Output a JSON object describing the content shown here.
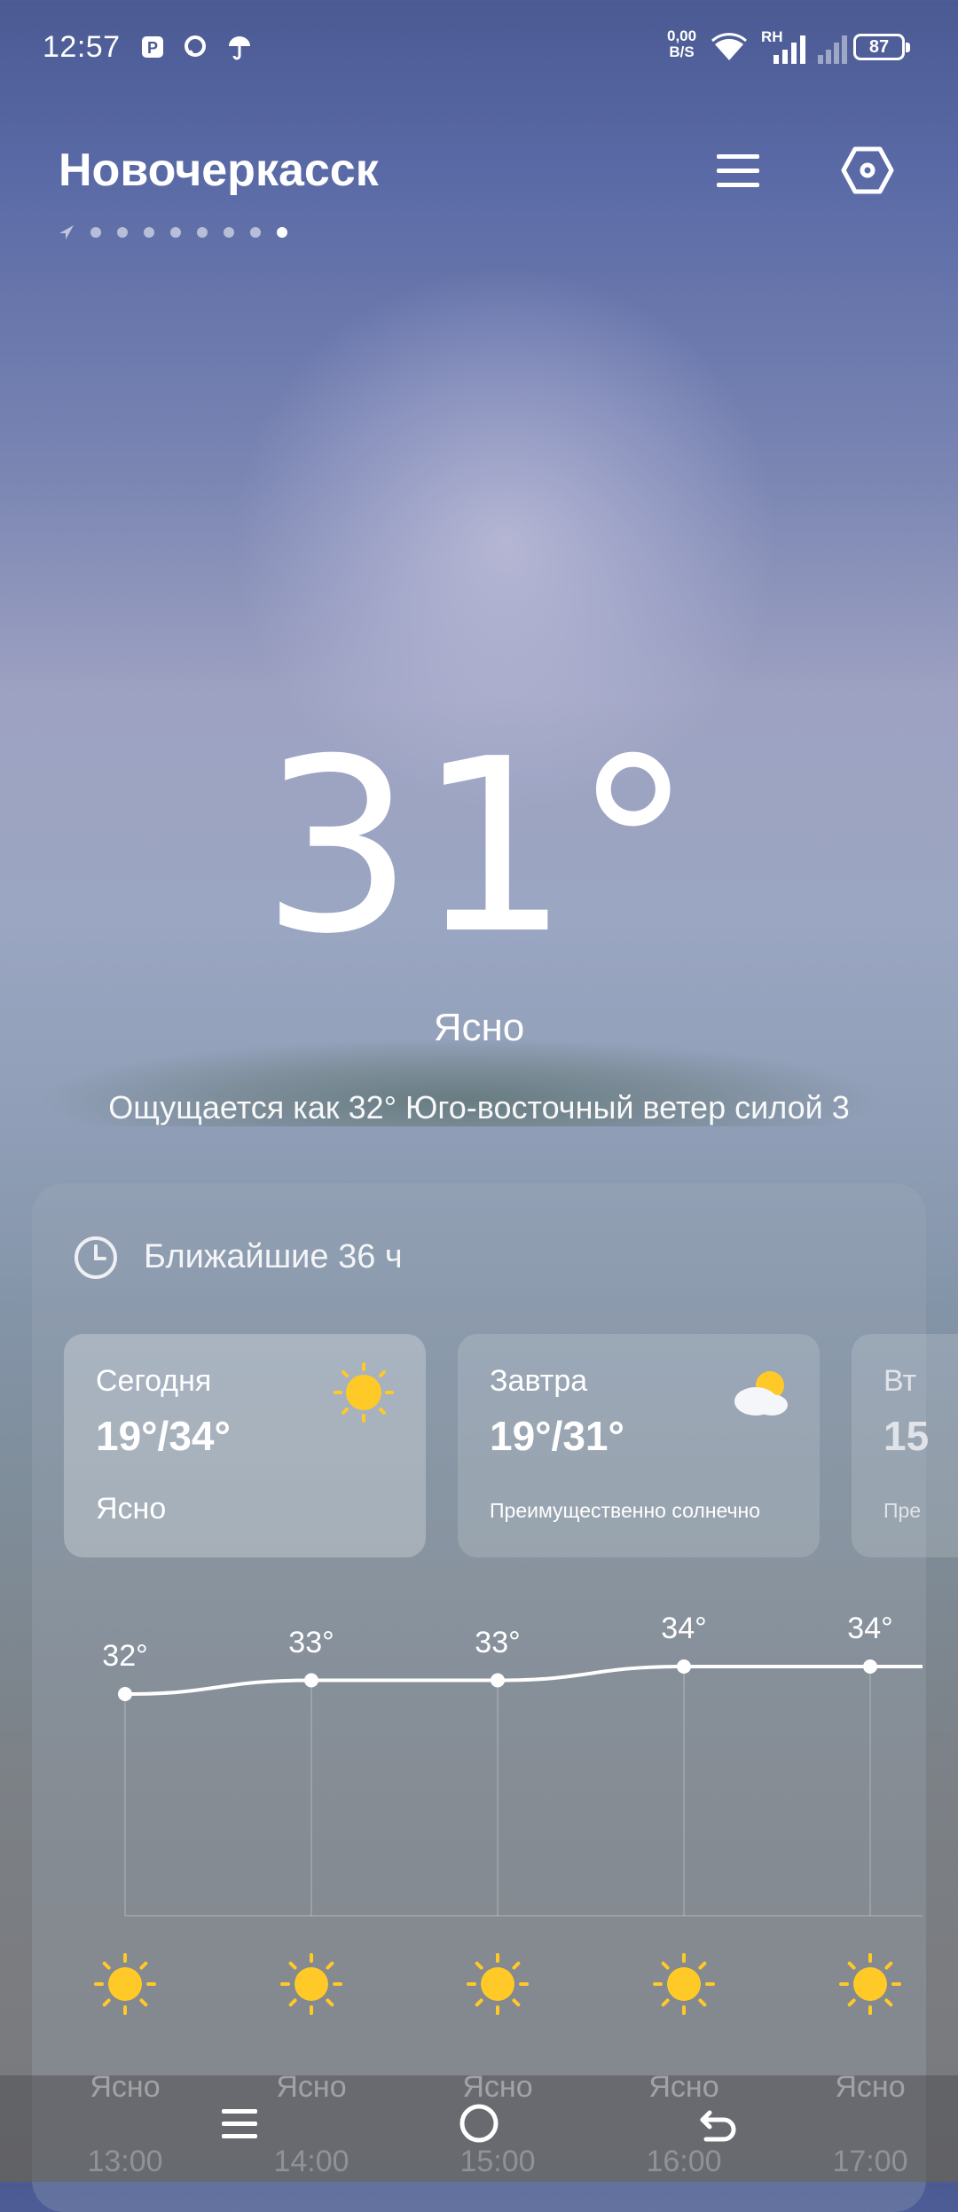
{
  "status_bar": {
    "time": "12:57",
    "net_speed_value": "0,00",
    "net_speed_unit": "B/S",
    "carrier": "RH",
    "battery": "87"
  },
  "header": {
    "city": "Новочеркасск",
    "menu_icon": "menu-icon",
    "settings_icon": "settings-hexagon-icon",
    "page_dots": 8,
    "active_page": 8
  },
  "current": {
    "temperature": "31°",
    "condition": "Ясно",
    "feels_like": "Ощущается как 32°  Юго-восточный ветер силой 3"
  },
  "forecast_card": {
    "title": "Ближайшие 36 ч",
    "days": [
      {
        "name": "Сегодня",
        "temps": "19°/34°",
        "desc": "Ясно",
        "icon": "sun-icon"
      },
      {
        "name": "Завтра",
        "temps": "19°/31°",
        "desc": "Преимущественно солнечно",
        "icon": "partly-cloudy-icon"
      },
      {
        "name": "Вт",
        "temps": "15",
        "desc": "Пре",
        "icon": ""
      }
    ],
    "hourly": [
      {
        "time": "13:00",
        "temp": "32°",
        "temp_value": 32,
        "cond": "Ясно",
        "icon": "sun-icon"
      },
      {
        "time": "14:00",
        "temp": "33°",
        "temp_value": 33,
        "cond": "Ясно",
        "icon": "sun-icon"
      },
      {
        "time": "15:00",
        "temp": "33°",
        "temp_value": 33,
        "cond": "Ясно",
        "icon": "sun-icon"
      },
      {
        "time": "16:00",
        "temp": "34°",
        "temp_value": 34,
        "cond": "Ясно",
        "icon": "sun-icon"
      },
      {
        "time": "17:00",
        "temp": "34°",
        "temp_value": 34,
        "cond": "Ясно",
        "icon": "sun-icon"
      }
    ]
  },
  "colors": {
    "sun": "#ffc928",
    "line": "#ffffff"
  }
}
